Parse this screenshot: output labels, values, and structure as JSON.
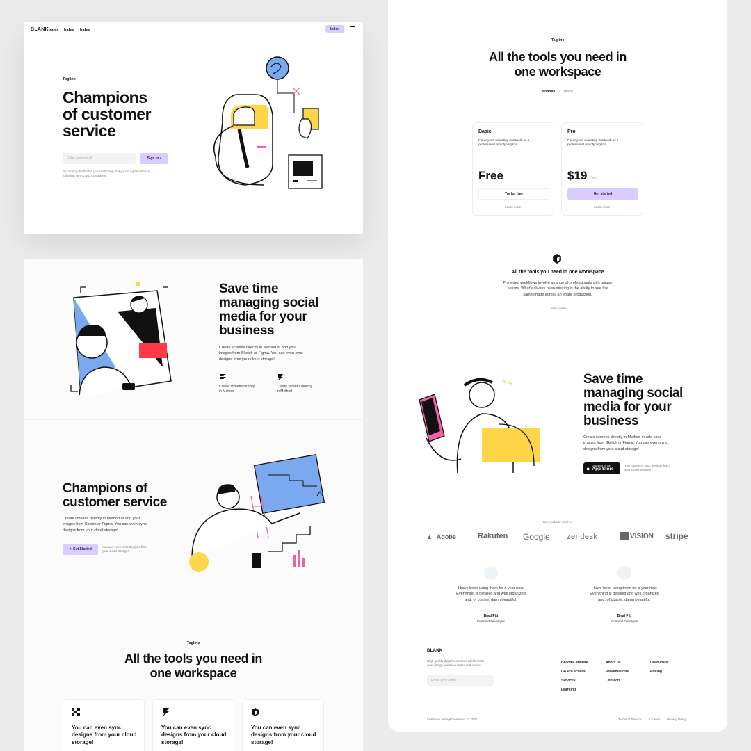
{
  "hero": {
    "brand": "BLANK",
    "nav": [
      "Index",
      "Index",
      "Index"
    ],
    "nav_button": "Index",
    "tagline": "Tagline",
    "title_lines": [
      "Champions",
      "of customer",
      "service"
    ],
    "email_placeholder": "Enter your email",
    "signin_label": "Sign In",
    "disclaimer_lines": [
      "By clicking the Button you confirming that you're agree with our",
      "following Terms and Conditions"
    ]
  },
  "social": {
    "title_lines": [
      "Save time",
      "managing social",
      "media for your",
      "business"
    ],
    "body_lines": [
      "Create screens directly in Method or add your",
      "images from Sketch or Figma. You can even sync",
      "designs from your cloud storage!"
    ],
    "features": [
      {
        "lines": [
          "Create screens directly",
          "in Method"
        ]
      },
      {
        "lines": [
          "Create screens directly",
          "in Method"
        ]
      }
    ]
  },
  "champions": {
    "title_lines": [
      "Champions of",
      "customer service"
    ],
    "body_lines": [
      "Create screens directly in Method or add your",
      "images from Sketch or Figma. You can even sync",
      "designs from your cloud storage!"
    ],
    "cta_label": "Get Started",
    "cta_note_lines": [
      "You can even sync designs from",
      "your cloud storage!"
    ]
  },
  "tools": {
    "tagline": "Tagline",
    "title_lines": [
      "All the tools you need in",
      "one workspace"
    ],
    "cards": [
      {
        "lines": [
          "You can even sync",
          "designs from your cloud",
          "storage!"
        ]
      },
      {
        "lines": [
          "You can even sync",
          "designs from your cloud",
          "storage!"
        ]
      },
      {
        "lines": [
          "You can even sync",
          "designs from your cloud",
          "storage!"
        ]
      }
    ]
  },
  "pricing": {
    "tagline": "Tagline",
    "title_lines": [
      "All the tools you need in",
      "one workspace"
    ],
    "tabs": [
      "Monthly",
      "Yearly"
    ],
    "plans": [
      {
        "name": "Basic",
        "desc_lines": [
          "For anyone validating Craftwork as a",
          "professional prototyping tool."
        ],
        "price": "Free",
        "unit": "",
        "button": "Try for free",
        "link": "Learn more"
      },
      {
        "name": "Pro",
        "desc_lines": [
          "For anyone validating Craftwork as a",
          "professional prototyping tool."
        ],
        "price": "$19",
        "unit": "/mo",
        "button": "Get started",
        "link": "Learn more"
      }
    ]
  },
  "workspace": {
    "title": "All the tools you need in one workspace",
    "body_lines": [
      "Pro video workflows involve a range of professionals with unique",
      "setups. What's always been missing is the ability to see the",
      "same image across an entire production."
    ],
    "link": "Learn more"
  },
  "social2": {
    "title_lines": [
      "Save time",
      "managing social",
      "media for your",
      "business"
    ],
    "body_lines": [
      "Create screens directly in Method or add your",
      "images from Sketch or Figma. You can even sync",
      "designs from your cloud storage!"
    ],
    "store_small": "Download on the",
    "store_big": "App Store",
    "store_note_lines": [
      "You can even sync designs from",
      "your cloud storage!"
    ]
  },
  "products": {
    "caption": "Our products used by",
    "logos": [
      "Adobe",
      "Rakuten",
      "Google",
      "zendesk",
      "VISION",
      "stripe"
    ]
  },
  "testimonials": [
    {
      "quote_lines": [
        "I have been using them for a year now.",
        "Everything is detailed and well organized",
        "and, of course, damn beautiful."
      ],
      "name": "Brad Pitt",
      "role": "Frontend Developer"
    },
    {
      "quote_lines": [
        "I have been using them for a year now.",
        "Everything is detailed and well organized",
        "and, of course, damn beautiful."
      ],
      "name": "Brad Pitt",
      "role": "Frontend Developer"
    }
  ],
  "footer": {
    "brand": "BLANK",
    "desc_lines": [
      "High quality digital resources which make",
      "your design workflow faster and easier."
    ],
    "email_placeholder": "Enter your email",
    "col1": [
      "Become affiliate",
      "Go Pro access",
      "Services",
      "Learning"
    ],
    "col2": [
      "About us",
      "Presentations",
      "Contacts"
    ],
    "col3": [
      "Downloads",
      "Pricing"
    ],
    "copyright": "Craftwork. All right reserved. © 2021",
    "legal": [
      "Terms of Service",
      "License",
      "Privacy Policy"
    ]
  },
  "colors": {
    "accent": "#d9ccff",
    "yellow": "#ffd54a",
    "blue": "#7aa9f0",
    "pink": "#f25fa6",
    "red": "#ff3b4a"
  }
}
